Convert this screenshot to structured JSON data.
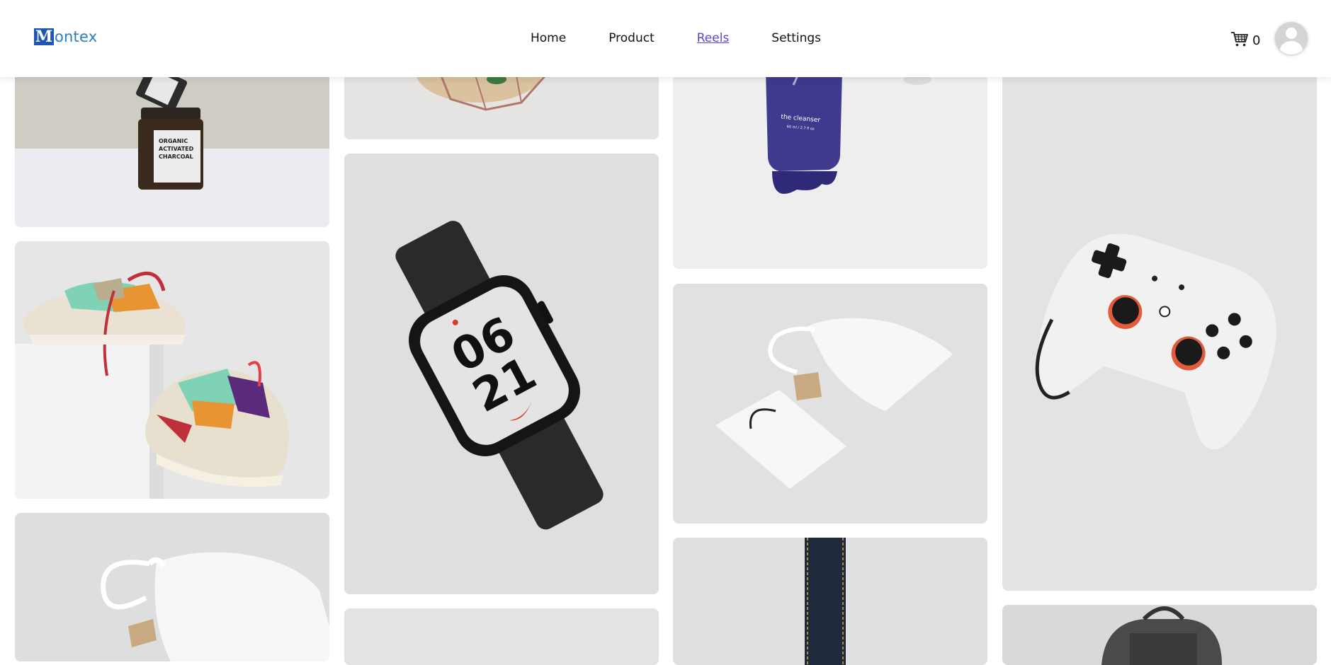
{
  "brand": {
    "logo_letter": "M",
    "logo_text": "ontex"
  },
  "nav": {
    "items": [
      {
        "label": "Home",
        "active": false
      },
      {
        "label": "Product",
        "active": false
      },
      {
        "label": "Reels",
        "active": true
      },
      {
        "label": "Settings",
        "active": false
      }
    ]
  },
  "cart": {
    "count": "0",
    "icon": "cart-icon"
  },
  "user": {
    "icon": "avatar-icon"
  },
  "gallery": {
    "items": [
      {
        "subject": "charcoal-jar",
        "jar_label_lines": [
          "ORGANIC",
          "ACTIVATED",
          "CHARCOAL"
        ]
      },
      {
        "subject": "sneakers"
      },
      {
        "subject": "drawstring-pouch"
      },
      {
        "subject": "glass-terrarium"
      },
      {
        "subject": "smartwatch",
        "watch_face": [
          "06",
          "21"
        ]
      },
      {
        "subject": "blank-product"
      },
      {
        "subject": "cleanser-tube",
        "tube_text": "the cleanser",
        "tube_subtext": "60 ml / 2.7 fl oz"
      },
      {
        "subject": "pouch-and-bag"
      },
      {
        "subject": "dark-leather-strap"
      },
      {
        "subject": "game-controller"
      },
      {
        "subject": "backpack"
      }
    ]
  },
  "colors": {
    "accent": "#5a47c8",
    "logo_blue": "#1f56b5",
    "logo_text": "#2a7fbf"
  }
}
